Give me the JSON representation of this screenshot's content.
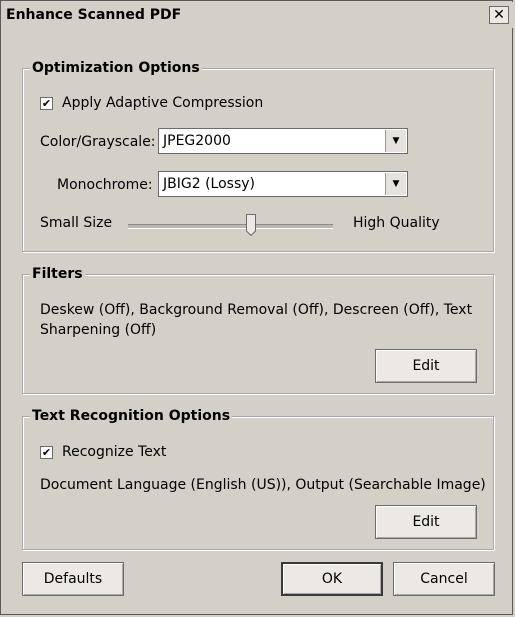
{
  "window": {
    "title": "Enhance Scanned PDF",
    "close_glyph": "✕"
  },
  "optimization": {
    "title": "Optimization Options",
    "adaptive_label": "Apply Adaptive Compression",
    "adaptive_checked": true,
    "color_label": "Color/Grayscale:",
    "color_value": "JPEG2000",
    "mono_label": "Monochrome:",
    "mono_value": "JBIG2 (Lossy)",
    "slider_min_label": "Small Size",
    "slider_max_label": "High Quality",
    "slider_value": 0.6
  },
  "filters": {
    "title": "Filters",
    "summary": "Deskew (Off), Background Removal (Off), Descreen (Off), Text Sharpening (Off)",
    "edit_label": "Edit"
  },
  "ocr": {
    "title": "Text Recognition Options",
    "recognize_label": "Recognize Text",
    "recognize_checked": true,
    "summary": "Document Language (English (US)), Output (Searchable Image)",
    "edit_label": "Edit"
  },
  "footer": {
    "defaults_label": "Defaults",
    "ok_label": "OK",
    "cancel_label": "Cancel"
  },
  "glyphs": {
    "check": "✔",
    "dropdown": "▼"
  }
}
